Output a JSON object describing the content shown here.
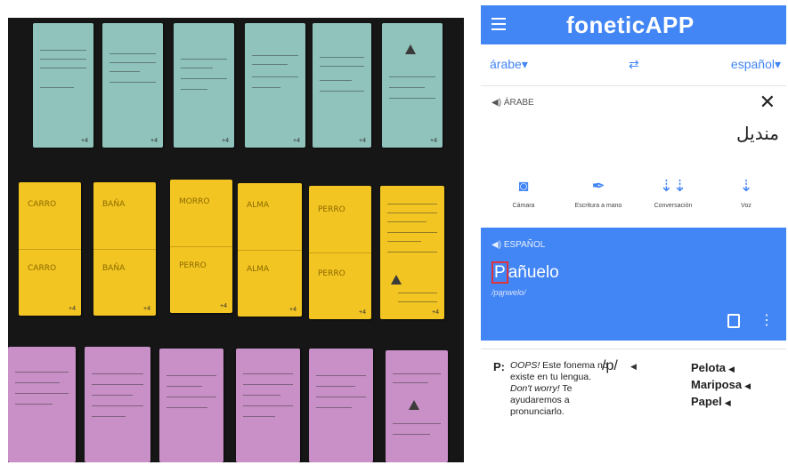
{
  "app": {
    "title": "foneticAPP",
    "menu_icon": "hamburger-menu-icon",
    "accent_color": "#4285f4"
  },
  "language_bar": {
    "from": "árabe",
    "to": "español",
    "swap_icon": "swap-arrows-icon"
  },
  "source": {
    "label": "ÁRABE",
    "text": "منديل",
    "close_icon": "close-icon"
  },
  "tools": [
    {
      "label": "Cámara",
      "icon": "camera-icon"
    },
    {
      "label": "Escritura a mano",
      "icon": "pen-icon"
    },
    {
      "label": "Conversación",
      "icon": "conversation-mic-icon"
    },
    {
      "label": "Voz",
      "icon": "mic-icon"
    }
  ],
  "target": {
    "label": "ESPAÑOL",
    "word_highlight": "P",
    "word_rest": "añuelo",
    "phonetic": "/pa̞ɲwelo/",
    "highlight_color": "#e0323a"
  },
  "result": {
    "letter": "P:",
    "message_oops": "OOPS!",
    "message_part1": " Este fonema no existe en tu lengua. ",
    "message_dontworry": "Don't worry!",
    "message_part2": " Te ayudaremos a pronunciarlo.",
    "phoneme": "/p/",
    "examples": [
      "Pelota",
      "Mariposa",
      "Papel"
    ]
  },
  "photo": {
    "card_rows": [
      {
        "color": "#8fc3bb",
        "cards": 6
      },
      {
        "color": "#f3c522",
        "cards": 6
      },
      {
        "color": "#c890c6",
        "cards": 6
      }
    ],
    "yellow_top_words": [
      "CARRO",
      "BAÑA",
      "MORRO",
      "ALMA",
      "PERRO"
    ],
    "yellow_bottom_words": [
      "CARRO",
      "BAÑA",
      "PERRO",
      "ALMA",
      "PERRO"
    ]
  }
}
